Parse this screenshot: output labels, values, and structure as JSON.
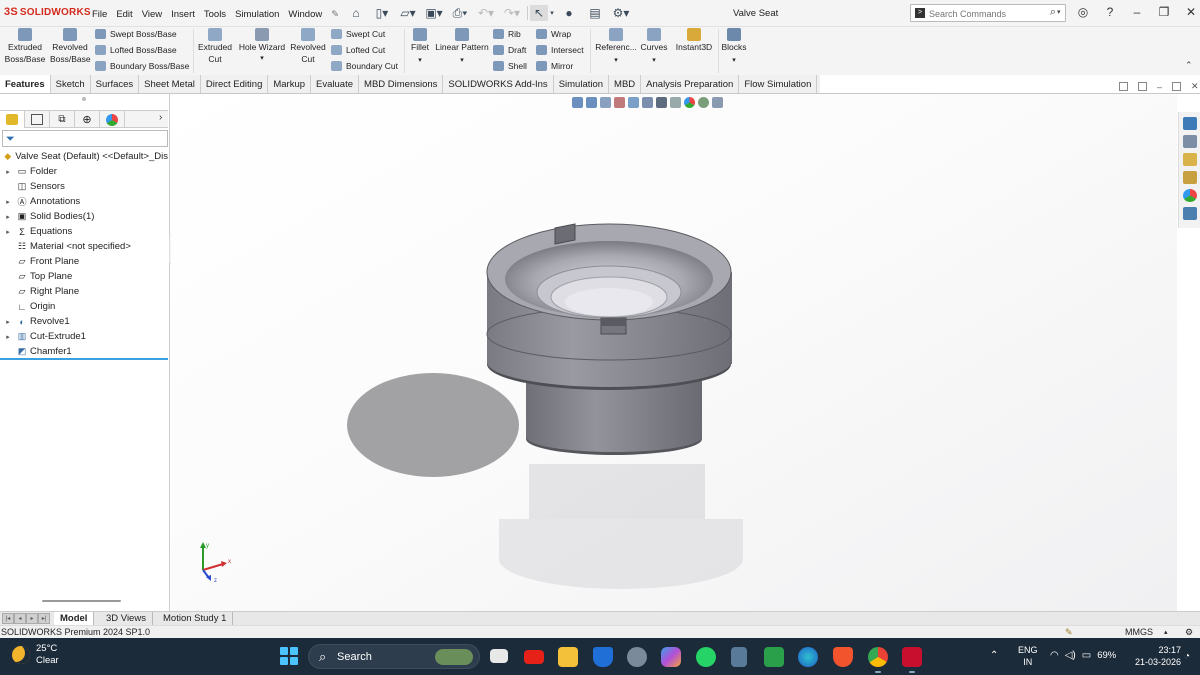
{
  "app": {
    "logo_text": "SOLIDWORKS",
    "logo_mark": "3S",
    "doc_title": "Valve Seat"
  },
  "menu": [
    "File",
    "Edit",
    "View",
    "Insert",
    "Tools",
    "Simulation",
    "Window"
  ],
  "search": {
    "placeholder": "Search Commands"
  },
  "ribbon": {
    "extruded_boss": "Extruded Boss/Base",
    "revolved_boss": "Revolved Boss/Base",
    "swept_boss": "Swept Boss/Base",
    "lofted_boss": "Lofted Boss/Base",
    "boundary_boss": "Boundary Boss/Base",
    "extruded_cut": "Extruded Cut",
    "hole_wizard": "Hole Wizard",
    "revolved_cut": "Revolved Cut",
    "swept_cut": "Swept Cut",
    "lofted_cut": "Lofted Cut",
    "boundary_cut": "Boundary Cut",
    "fillet": "Fillet",
    "linear_pattern": "Linear Pattern",
    "rib": "Rib",
    "draft": "Draft",
    "shell": "Shell",
    "wrap": "Wrap",
    "intersect": "Intersect",
    "mirror": "Mirror",
    "reference": "Referenc...",
    "curves": "Curves",
    "instant3d": "Instant3D",
    "blocks": "Blocks"
  },
  "tabs": [
    "Features",
    "Sketch",
    "Surfaces",
    "Sheet Metal",
    "Direct Editing",
    "Markup",
    "Evaluate",
    "MBD Dimensions",
    "SOLIDWORKS Add-Ins",
    "Simulation",
    "MBD",
    "Analysis Preparation",
    "Flow Simulation"
  ],
  "tree": {
    "root": "Valve Seat (Default) <<Default>_Dis",
    "items": [
      "Folder",
      "Sensors",
      "Annotations",
      "Solid Bodies(1)",
      "Equations",
      "Material <not specified>",
      "Front Plane",
      "Top Plane",
      "Right Plane",
      "Origin",
      "Revolve1",
      "Cut-Extrude1",
      "Chamfer1"
    ]
  },
  "triad": {
    "x": "x",
    "y": "y",
    "z": "z"
  },
  "bottom_tabs": [
    "Model",
    "3D Views",
    "Motion Study 1"
  ],
  "status": {
    "text": "SOLIDWORKS Premium 2024 SP1.0",
    "units": "MMGS"
  },
  "taskbar": {
    "temp": "25°C",
    "weather": "Clear",
    "search": "Search",
    "lang1": "ENG",
    "lang2": "IN",
    "battery": "69%",
    "time": "23:17",
    "date": "21-03-2026"
  },
  "colors": {
    "accent": "#3aa0e0",
    "brand": "#d52b1e",
    "model_gray": "#8a8a92"
  }
}
